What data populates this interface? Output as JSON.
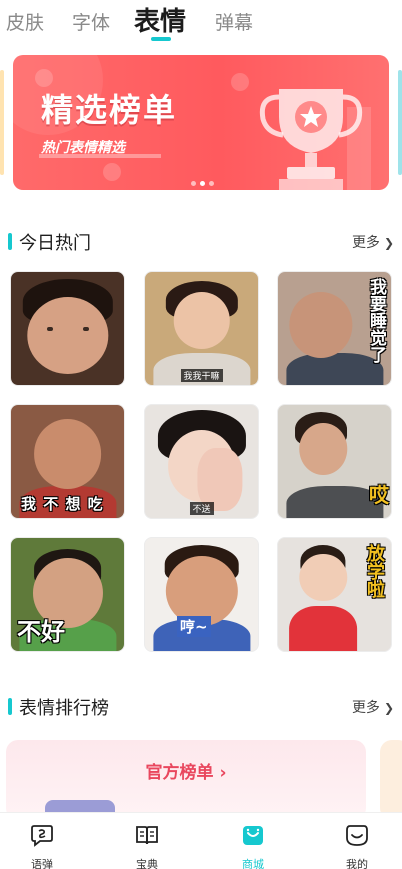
{
  "top_tabs": [
    {
      "label": "皮肤",
      "active": false
    },
    {
      "label": "字体",
      "active": false
    },
    {
      "label": "表情",
      "active": true
    },
    {
      "label": "弹幕",
      "active": false
    }
  ],
  "banner": {
    "title": "精选榜单",
    "subtitle": "热门表情精选",
    "dots": 3,
    "active_dot": 1
  },
  "today_hot": {
    "title": "今日热门",
    "more": "更多"
  },
  "stickers": [
    {
      "caption": ""
    },
    {
      "caption": "我我干嘛"
    },
    {
      "caption": "我要睡觉了"
    },
    {
      "caption": "我 不 想 吃"
    },
    {
      "caption": "不送"
    },
    {
      "caption": "哎"
    },
    {
      "caption": "不好"
    },
    {
      "caption": "哼~"
    },
    {
      "caption": "放学啦"
    }
  ],
  "ranking": {
    "title": "表情排行榜",
    "more": "更多",
    "card_title": "官方榜单 ›"
  },
  "bottom_nav": [
    {
      "label": "语弹",
      "icon": "chat-bubble-icon",
      "active": false
    },
    {
      "label": "宝典",
      "icon": "book-icon",
      "active": false
    },
    {
      "label": "商城",
      "icon": "shop-bag-icon",
      "active": true
    },
    {
      "label": "我的",
      "icon": "smile-face-icon",
      "active": false
    }
  ],
  "colors": {
    "accent": "#16c8cf",
    "banner": "#ff5a5e",
    "rank_title": "#e9475e"
  }
}
